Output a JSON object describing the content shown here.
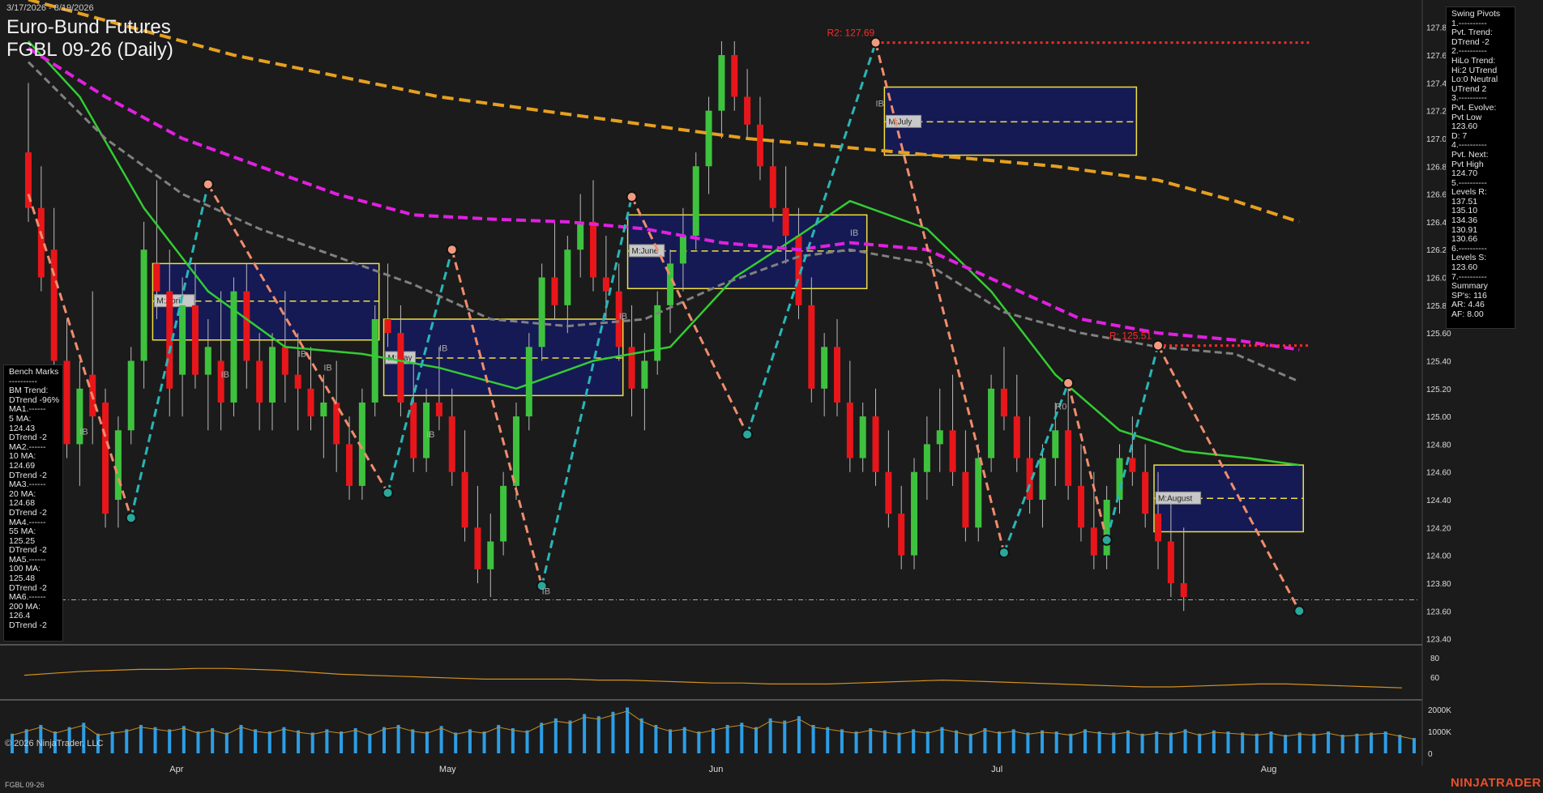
{
  "header": {
    "date_range": "3/17/2026 - 8/19/2026",
    "title": "Euro-Bund Futures",
    "subtitle": "FGBL 09-26 (Daily)"
  },
  "footer": {
    "copyright": "© 2026 NinjaTrader, LLC",
    "symbol": "FGBL 09-26",
    "brand": "NINJATRADER"
  },
  "swing_panel": {
    "lines": [
      "Swing Pivots",
      "1.----------",
      "Pvt. Trend:",
      "DTrend -2",
      "2.----------",
      "HiLo Trend:",
      "Hi:2 UTrend",
      "Lo:0 Neutral",
      "UTrend 2",
      "3.----------",
      "Pvt. Evolve:",
      "Pvt Low",
      "123.60",
      "D: 7",
      "4.----------",
      "Pvt. Next:",
      "Pvt High",
      "124.70",
      "5.----------",
      "Levels R:",
      "137.51",
      "135.10",
      "134.36",
      "130.91",
      "130.66",
      "6.----------",
      "Levels S:",
      "123.60",
      "7.----------",
      "Summary",
      "SP's: 116",
      "AR: 4.46",
      "AF: 8.00"
    ]
  },
  "bench_panel": {
    "lines": [
      "Bench Marks",
      "----------",
      "BM Trend:",
      "DTrend -96%",
      "MA1.------",
      "5 MA:",
      "124.43",
      "DTrend -2",
      "MA2.------",
      "10 MA:",
      "124.69",
      "DTrend -2",
      "MA3.------",
      "20 MA:",
      "124.68",
      "DTrend -2",
      "MA4.------",
      "55 MA:",
      "125.25",
      "DTrend -2",
      "MA5.------",
      "100 MA:",
      "125.48",
      "DTrend -2",
      "MA6.------",
      "200 MA:",
      "126.4",
      "DTrend -2"
    ]
  },
  "colors": {
    "background": "#1b1b1b",
    "up_candle": "#3ec23e",
    "down_candle": "#e8161a",
    "ma_green": "#33cc33",
    "ma_gray": "#808080",
    "ma_magenta": "#e020e0",
    "ma_orange": "#e6a020",
    "swing_up": "#29b6b6",
    "swing_down": "#f08c6c",
    "resistance": "#ff2a2a",
    "vol_bar": "#2c9ee6",
    "box_fill": "#141a5e",
    "box_border": "#f0e040"
  },
  "chart_data": {
    "type": "candlestick",
    "y_axis_ticks": [
      127.8,
      127.6,
      127.4,
      127.2,
      127.0,
      126.8,
      126.6,
      126.4,
      126.2,
      126.0,
      125.8,
      125.6,
      125.4,
      125.2,
      125.0,
      124.8,
      124.6,
      124.4,
      124.2,
      124.0,
      123.8,
      123.6,
      123.4
    ],
    "ylim": [
      123.38,
      127.95
    ],
    "x_month_labels": [
      {
        "label": "Apr",
        "day": 11
      },
      {
        "label": "May",
        "day": 32
      },
      {
        "label": "Jun",
        "day": 53
      },
      {
        "label": "Jul",
        "day": 75
      },
      {
        "label": "Aug",
        "day": 96
      }
    ],
    "days": 108,
    "candles": [
      [
        126.9,
        127.4,
        126.4,
        126.5
      ],
      [
        126.5,
        126.8,
        125.9,
        126.0
      ],
      [
        126.2,
        126.5,
        125.3,
        125.4
      ],
      [
        125.4,
        125.7,
        124.7,
        124.8
      ],
      [
        124.8,
        125.4,
        124.5,
        125.2
      ],
      [
        125.3,
        125.9,
        124.8,
        125.0
      ],
      [
        125.1,
        125.2,
        124.2,
        124.3
      ],
      [
        124.4,
        125.0,
        124.2,
        124.9
      ],
      [
        124.9,
        125.5,
        124.8,
        125.4
      ],
      [
        125.4,
        126.4,
        125.2,
        126.2
      ],
      [
        126.1,
        126.7,
        125.7,
        125.9
      ],
      [
        125.9,
        126.2,
        125.0,
        125.2
      ],
      [
        125.3,
        126.0,
        125.0,
        125.8
      ],
      [
        125.8,
        126.1,
        125.2,
        125.3
      ],
      [
        125.3,
        125.7,
        124.9,
        125.5
      ],
      [
        125.4,
        125.9,
        124.9,
        125.1
      ],
      [
        125.1,
        126.0,
        125.0,
        125.9
      ],
      [
        125.9,
        126.1,
        125.2,
        125.4
      ],
      [
        125.4,
        125.6,
        124.9,
        125.1
      ],
      [
        125.1,
        125.6,
        124.9,
        125.5
      ],
      [
        125.5,
        125.9,
        125.1,
        125.3
      ],
      [
        125.3,
        125.6,
        124.9,
        125.2
      ],
      [
        125.2,
        125.5,
        124.9,
        125.0
      ],
      [
        125.0,
        125.3,
        124.7,
        125.1
      ],
      [
        125.1,
        125.4,
        124.6,
        124.8
      ],
      [
        124.8,
        125.0,
        124.4,
        124.5
      ],
      [
        124.5,
        125.2,
        124.4,
        125.1
      ],
      [
        125.1,
        125.8,
        125.0,
        125.7
      ],
      [
        125.7,
        126.1,
        125.5,
        125.6
      ],
      [
        125.6,
        125.8,
        125.0,
        125.1
      ],
      [
        125.1,
        125.4,
        124.6,
        124.7
      ],
      [
        124.7,
        125.2,
        124.6,
        125.1
      ],
      [
        125.1,
        125.5,
        124.9,
        125.0
      ],
      [
        125.0,
        125.2,
        124.5,
        124.6
      ],
      [
        124.6,
        124.9,
        124.1,
        124.2
      ],
      [
        124.2,
        124.5,
        123.8,
        123.9
      ],
      [
        123.9,
        124.3,
        123.7,
        124.1
      ],
      [
        124.1,
        124.6,
        124.0,
        124.5
      ],
      [
        124.5,
        125.1,
        124.4,
        125.0
      ],
      [
        125.0,
        125.6,
        124.9,
        125.5
      ],
      [
        125.5,
        126.1,
        125.4,
        126.0
      ],
      [
        126.0,
        126.4,
        125.7,
        125.8
      ],
      [
        125.8,
        126.3,
        125.6,
        126.2
      ],
      [
        126.2,
        126.6,
        126.0,
        126.4
      ],
      [
        126.4,
        126.7,
        125.9,
        126.0
      ],
      [
        126.0,
        126.3,
        125.7,
        125.9
      ],
      [
        125.9,
        126.1,
        125.4,
        125.5
      ],
      [
        125.5,
        125.8,
        125.0,
        125.2
      ],
      [
        125.2,
        125.6,
        124.9,
        125.4
      ],
      [
        125.4,
        125.9,
        125.3,
        125.8
      ],
      [
        125.8,
        126.2,
        125.6,
        126.1
      ],
      [
        126.1,
        126.5,
        125.9,
        126.3
      ],
      [
        126.3,
        126.9,
        126.2,
        126.8
      ],
      [
        126.8,
        127.3,
        126.6,
        127.2
      ],
      [
        127.2,
        127.7,
        127.0,
        127.6
      ],
      [
        127.6,
        127.7,
        127.2,
        127.3
      ],
      [
        127.3,
        127.5,
        127.0,
        127.1
      ],
      [
        127.1,
        127.3,
        126.7,
        126.8
      ],
      [
        126.8,
        127.0,
        126.4,
        126.5
      ],
      [
        126.5,
        126.8,
        126.1,
        126.3
      ],
      [
        126.3,
        126.5,
        125.7,
        125.8
      ],
      [
        125.8,
        126.0,
        125.1,
        125.2
      ],
      [
        125.2,
        125.6,
        125.0,
        125.5
      ],
      [
        125.5,
        125.7,
        125.0,
        125.1
      ],
      [
        125.1,
        125.4,
        124.6,
        124.7
      ],
      [
        124.7,
        125.1,
        124.6,
        125.0
      ],
      [
        125.0,
        125.2,
        124.5,
        124.6
      ],
      [
        124.6,
        124.9,
        124.2,
        124.3
      ],
      [
        124.3,
        124.5,
        123.9,
        124.0
      ],
      [
        124.0,
        124.7,
        123.9,
        124.6
      ],
      [
        124.6,
        125.0,
        124.4,
        124.8
      ],
      [
        124.8,
        125.2,
        124.6,
        124.9
      ],
      [
        124.9,
        125.3,
        124.5,
        124.6
      ],
      [
        124.6,
        124.9,
        124.1,
        124.2
      ],
      [
        124.2,
        124.8,
        124.1,
        124.7
      ],
      [
        124.7,
        125.3,
        124.6,
        125.2
      ],
      [
        125.2,
        125.5,
        124.9,
        125.0
      ],
      [
        125.0,
        125.3,
        124.6,
        124.7
      ],
      [
        124.7,
        125.0,
        124.3,
        124.4
      ],
      [
        124.4,
        124.8,
        124.2,
        124.7
      ],
      [
        124.7,
        125.1,
        124.5,
        124.9
      ],
      [
        124.9,
        125.2,
        124.4,
        124.5
      ],
      [
        124.5,
        124.8,
        124.1,
        124.2
      ],
      [
        124.2,
        124.6,
        123.9,
        124.0
      ],
      [
        124.0,
        124.5,
        123.9,
        124.4
      ],
      [
        124.4,
        124.8,
        124.3,
        124.7
      ],
      [
        124.7,
        125.0,
        124.5,
        124.6
      ],
      [
        124.6,
        124.8,
        124.2,
        124.3
      ],
      [
        124.3,
        124.6,
        123.9,
        124.1
      ],
      [
        124.1,
        124.4,
        123.7,
        123.8
      ],
      [
        123.8,
        124.2,
        123.6,
        123.7
      ]
    ],
    "moving_averages": [
      {
        "name": "MA 20",
        "color": "#33cc33",
        "dash": "",
        "width": 2.5,
        "points": [
          [
            0,
            127.7
          ],
          [
            4,
            127.3
          ],
          [
            9,
            126.5
          ],
          [
            14,
            125.9
          ],
          [
            20,
            125.5
          ],
          [
            26,
            125.45
          ],
          [
            32,
            125.35
          ],
          [
            38,
            125.2
          ],
          [
            44,
            125.4
          ],
          [
            50,
            125.5
          ],
          [
            55,
            126.0
          ],
          [
            60,
            126.3
          ],
          [
            64,
            126.55
          ],
          [
            70,
            126.35
          ],
          [
            75,
            125.9
          ],
          [
            80,
            125.3
          ],
          [
            85,
            124.9
          ],
          [
            90,
            124.75
          ],
          [
            95,
            124.7
          ],
          [
            99,
            124.65
          ]
        ]
      },
      {
        "name": "MA 55",
        "color": "#808080",
        "dash": "9,5",
        "width": 3,
        "points": [
          [
            0,
            127.55
          ],
          [
            6,
            127.0
          ],
          [
            12,
            126.6
          ],
          [
            18,
            126.35
          ],
          [
            24,
            126.15
          ],
          [
            30,
            125.95
          ],
          [
            36,
            125.7
          ],
          [
            42,
            125.65
          ],
          [
            48,
            125.7
          ],
          [
            54,
            125.95
          ],
          [
            60,
            126.15
          ],
          [
            64,
            126.2
          ],
          [
            70,
            126.1
          ],
          [
            76,
            125.75
          ],
          [
            82,
            125.6
          ],
          [
            88,
            125.5
          ],
          [
            94,
            125.45
          ],
          [
            99,
            125.25
          ]
        ]
      },
      {
        "name": "MA 100",
        "color": "#e020e0",
        "dash": "12,6",
        "width": 4,
        "points": [
          [
            0,
            127.65
          ],
          [
            6,
            127.3
          ],
          [
            12,
            127.0
          ],
          [
            18,
            126.8
          ],
          [
            24,
            126.6
          ],
          [
            30,
            126.45
          ],
          [
            36,
            126.42
          ],
          [
            42,
            126.4
          ],
          [
            48,
            126.35
          ],
          [
            54,
            126.25
          ],
          [
            60,
            126.2
          ],
          [
            64,
            126.25
          ],
          [
            70,
            126.2
          ],
          [
            76,
            125.95
          ],
          [
            82,
            125.7
          ],
          [
            88,
            125.6
          ],
          [
            94,
            125.55
          ],
          [
            99,
            125.48
          ]
        ]
      },
      {
        "name": "MA 200",
        "color": "#e6a020",
        "dash": "14,7",
        "width": 4,
        "points": [
          [
            0,
            128.0
          ],
          [
            8,
            127.8
          ],
          [
            16,
            127.6
          ],
          [
            24,
            127.45
          ],
          [
            32,
            127.3
          ],
          [
            40,
            127.2
          ],
          [
            48,
            127.1
          ],
          [
            56,
            127.0
          ],
          [
            62,
            126.95
          ],
          [
            68,
            126.9
          ],
          [
            74,
            126.85
          ],
          [
            80,
            126.8
          ],
          [
            88,
            126.7
          ],
          [
            94,
            126.55
          ],
          [
            99,
            126.4
          ]
        ]
      }
    ],
    "swing_zigzag": [
      [
        0,
        126.6
      ],
      [
        8,
        124.27
      ],
      [
        14,
        126.67
      ],
      [
        28,
        124.45
      ],
      [
        33,
        126.2
      ],
      [
        40,
        123.78
      ],
      [
        47,
        126.58
      ],
      [
        56,
        124.87
      ],
      [
        66,
        127.69
      ],
      [
        76,
        124.02
      ],
      [
        81,
        125.24
      ],
      [
        84,
        124.11
      ],
      [
        88,
        125.51
      ],
      [
        99,
        123.6
      ]
    ],
    "resistance_lines": [
      {
        "label": "R2: 127.69",
        "value": 127.69,
        "from": 66,
        "to": 99
      },
      {
        "label": "R: 125.51",
        "value": 125.51,
        "from": 88,
        "to": 99
      }
    ],
    "boxes": [
      {
        "label": "M:April",
        "from": 10,
        "to": 27,
        "hi": 126.1,
        "lo": 125.55,
        "mid": 125.83
      },
      {
        "label": "M:May",
        "from": 28,
        "to": 46,
        "hi": 125.7,
        "lo": 125.15,
        "mid": 125.42
      },
      {
        "label": "M:June",
        "from": 47,
        "to": 65,
        "hi": 126.45,
        "lo": 125.92,
        "mid": 126.19
      },
      {
        "label": "M:July",
        "from": 67,
        "to": 86,
        "hi": 127.37,
        "lo": 126.88,
        "mid": 127.12
      },
      {
        "label": "M:August",
        "from": 88,
        "to": 99,
        "hi": 124.65,
        "lo": 124.17,
        "mid": 124.41
      }
    ],
    "annotations": [
      "IB",
      "IB",
      "IB",
      "IB",
      "IB",
      "IB",
      "IB",
      "IB",
      "IB",
      "IB",
      "R0"
    ],
    "oscillator_ticks": [
      80,
      60
    ],
    "oscillator": [
      62,
      64,
      66,
      67,
      68,
      68,
      69,
      69,
      68,
      67,
      65,
      63,
      62,
      61,
      60,
      59,
      58,
      58,
      58,
      58,
      57,
      57,
      56,
      55,
      54,
      54,
      53,
      53,
      53,
      54,
      55,
      56,
      57,
      56,
      55,
      54,
      53,
      52,
      51,
      50,
      50,
      51,
      52,
      53,
      53,
      52,
      51,
      50,
      49
    ],
    "volume_ticks": [
      "2000K",
      "1000K",
      "0"
    ],
    "volume_max": 2300,
    "volume": [
      900,
      1100,
      1300,
      1000,
      1200,
      1400,
      900,
      1000,
      1100,
      1300,
      1200,
      1100,
      1250,
      1000,
      1150,
      950,
      1300,
      1100,
      1000,
      1200,
      1050,
      950,
      1100,
      1000,
      1150,
      900,
      1200,
      1300,
      1100,
      1000,
      1250,
      950,
      1100,
      1000,
      1300,
      1150,
      1050,
      1400,
      1600,
      1500,
      1800,
      1700,
      1900,
      2100,
      1600,
      1300,
      1100,
      1200,
      1000,
      1150,
      1300,
      1400,
      1200,
      1600,
      1500,
      1700,
      1300,
      1200,
      1100,
      1000,
      1150,
      1050,
      950,
      1100,
      1000,
      1200,
      1050,
      900,
      1150,
      1000,
      1100,
      950,
      1050,
      1000,
      900,
      1100,
      1000,
      950,
      1050,
      900,
      1000,
      950,
      1100,
      900,
      1050,
      1000,
      950,
      900,
      1000,
      850,
      950,
      900,
      1000,
      850,
      900,
      950,
      1000,
      850,
      700
    ]
  }
}
